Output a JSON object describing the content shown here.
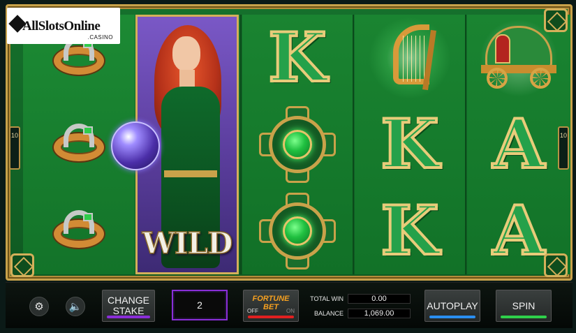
{
  "brand": {
    "name": "AllSlotsOnline",
    "suffix": ".CASINO"
  },
  "game": {
    "paylines_left": "10",
    "paylines_right": "10",
    "wild_label": "WILD",
    "reels": [
      [
        "ring-horseshoe",
        "ring-horseshoe",
        "ring-horseshoe"
      ],
      [
        "wild-fortune-teller",
        "wild-fortune-teller",
        "wild-fortune-teller"
      ],
      [
        "K",
        "celtic-brooch",
        "celtic-brooch"
      ],
      [
        "harp",
        "K",
        "K"
      ],
      [
        "gypsy-wagon",
        "A",
        "A"
      ]
    ],
    "letter_symbols": {
      "r3_top": "K",
      "r4_mid": "K",
      "r4_bot": "K",
      "r5_mid": "A",
      "r5_bot": "A"
    },
    "colors": {
      "felt": "#15702c",
      "gold_frame": "#c8a24a",
      "wild_bg": "#7a58c6"
    }
  },
  "controls": {
    "settings_icon": "gear-icon",
    "sound_icon": "speaker-icon",
    "change_stake_line1": "CHANGE",
    "change_stake_line2": "STAKE",
    "stake_value": "2",
    "fortune_bet_line1": "FORTUNE",
    "fortune_bet_line2": "BET",
    "fortune_off": "OFF",
    "fortune_on": "ON",
    "total_win_label": "TOTAL WIN",
    "total_win_value": "0.00",
    "balance_label": "BALANCE",
    "balance_value": "1,069.00",
    "autoplay_label": "AUTOPLAY",
    "spin_label": "SPIN",
    "accent_colors": {
      "stake": "#8a2ed8",
      "fortune": "#e02020",
      "autoplay": "#2a8ef0",
      "spin": "#2fd04a"
    }
  }
}
